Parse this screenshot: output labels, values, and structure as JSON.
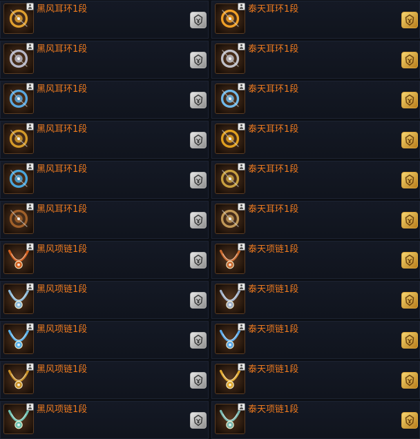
{
  "theme": {
    "name_color": "#ee7a1e",
    "silver_badge": "#cfcfcf",
    "gold_badge": "#e2b04a"
  },
  "left_column": {
    "items": [
      {
        "name": "黑风耳环1段",
        "icon": "dark-wind-earring-icon",
        "glow": "#e0a030"
      },
      {
        "name": "黑风耳环1段",
        "icon": "dark-wind-earring-icon",
        "glow": "#b8b8c8"
      },
      {
        "name": "黑风耳环1段",
        "icon": "dark-wind-earring-icon",
        "glow": "#5aa8e0"
      },
      {
        "name": "黑风耳环1段",
        "icon": "dark-wind-earring-icon",
        "glow": "#d49a2a"
      },
      {
        "name": "黑风耳环1段",
        "icon": "dark-wind-earring-icon",
        "glow": "#4aa6dc"
      },
      {
        "name": "黑风耳环1段",
        "icon": "dark-wind-earring-icon",
        "glow": "#a0602a"
      },
      {
        "name": "黑风项链1段",
        "icon": "dark-wind-necklace-icon",
        "glow": "#d06020"
      },
      {
        "name": "黑风项链1段",
        "icon": "dark-wind-necklace-icon",
        "glow": "#8ab8d8"
      },
      {
        "name": "黑风项链1段",
        "icon": "dark-wind-necklace-icon",
        "glow": "#58b0e8"
      },
      {
        "name": "黑风项链1段",
        "icon": "dark-wind-necklace-icon",
        "glow": "#c89028"
      },
      {
        "name": "黑风项链1段",
        "icon": "dark-wind-necklace-icon",
        "glow": "#6ec0b0"
      }
    ],
    "badge_type": "silver",
    "badge_icon": "silver-crest-icon"
  },
  "right_column": {
    "items": [
      {
        "name": "泰天耳环1段",
        "icon": "taitian-earring-icon",
        "glow": "#f0a028"
      },
      {
        "name": "泰天耳环1段",
        "icon": "taitian-earring-icon",
        "glow": "#c0c0c8"
      },
      {
        "name": "泰天耳环1段",
        "icon": "taitian-earring-icon",
        "glow": "#70b8e8"
      },
      {
        "name": "泰天耳环1段",
        "icon": "taitian-earring-icon",
        "glow": "#e0a020"
      },
      {
        "name": "泰天耳环1段",
        "icon": "taitian-earring-icon",
        "glow": "#c8a040"
      },
      {
        "name": "泰天耳环1段",
        "icon": "taitian-earring-icon",
        "glow": "#c09858"
      },
      {
        "name": "泰天项链1段",
        "icon": "taitian-necklace-icon",
        "glow": "#c86a30"
      },
      {
        "name": "泰天项链1段",
        "icon": "taitian-necklace-icon",
        "glow": "#a0b0c8"
      },
      {
        "name": "泰天项链1段",
        "icon": "taitian-necklace-icon",
        "glow": "#5aa8e8"
      },
      {
        "name": "泰天项链1段",
        "icon": "taitian-necklace-icon",
        "glow": "#e0a830"
      },
      {
        "name": "泰天项链1段",
        "icon": "taitian-necklace-icon",
        "glow": "#7ab8b0"
      }
    ],
    "badge_type": "gold",
    "badge_icon": "gold-crest-icon"
  }
}
